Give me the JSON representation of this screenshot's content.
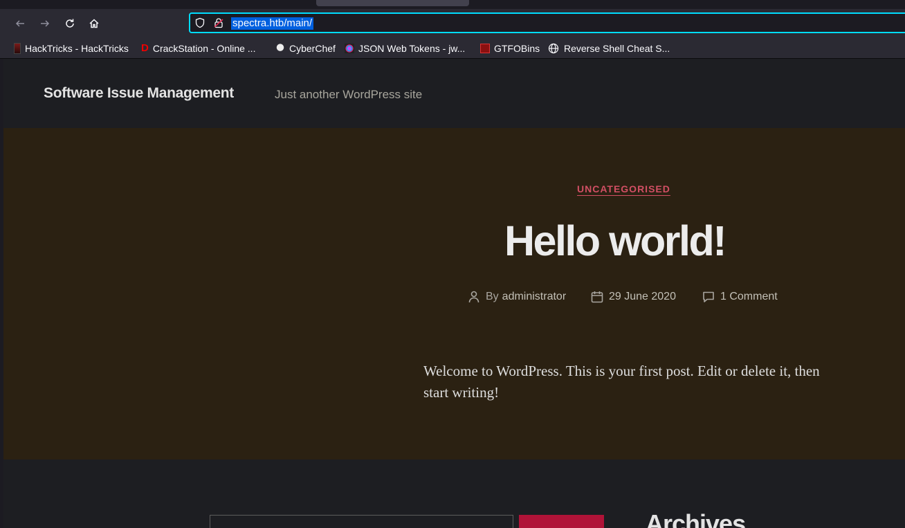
{
  "browser": {
    "url": "spectra.htb/main/",
    "bookmarks": [
      {
        "label": "HackTricks - HackTricks",
        "icon": "hacktricks-icon"
      },
      {
        "label": "CrackStation - Online ...",
        "icon": "crackstation-icon"
      },
      {
        "label": "CyberChef",
        "icon": "cyberchef-icon"
      },
      {
        "label": "JSON Web Tokens - jw...",
        "icon": "jwt-icon"
      },
      {
        "label": "GTFOBins",
        "icon": "gtfobins-icon"
      },
      {
        "label": "Reverse Shell Cheat S...",
        "icon": "globe-icon"
      }
    ]
  },
  "site": {
    "title": "Software Issue Management",
    "description": "Just another WordPress site"
  },
  "post": {
    "category": "UNCATEGORISED",
    "title": "Hello world!",
    "author_prefix": "By",
    "author": "administrator",
    "date": "29 June 2020",
    "comments": "1 Comment",
    "excerpt": "Welcome to WordPress. This is your first post. Edit or delete it, then start writing!"
  },
  "sidebar": {
    "archives_title": "Archives"
  },
  "colors": {
    "accent": "#d24f64",
    "hero_bg": "#2b2112",
    "search_button": "#b01338",
    "url_focus": "#00ddff"
  }
}
